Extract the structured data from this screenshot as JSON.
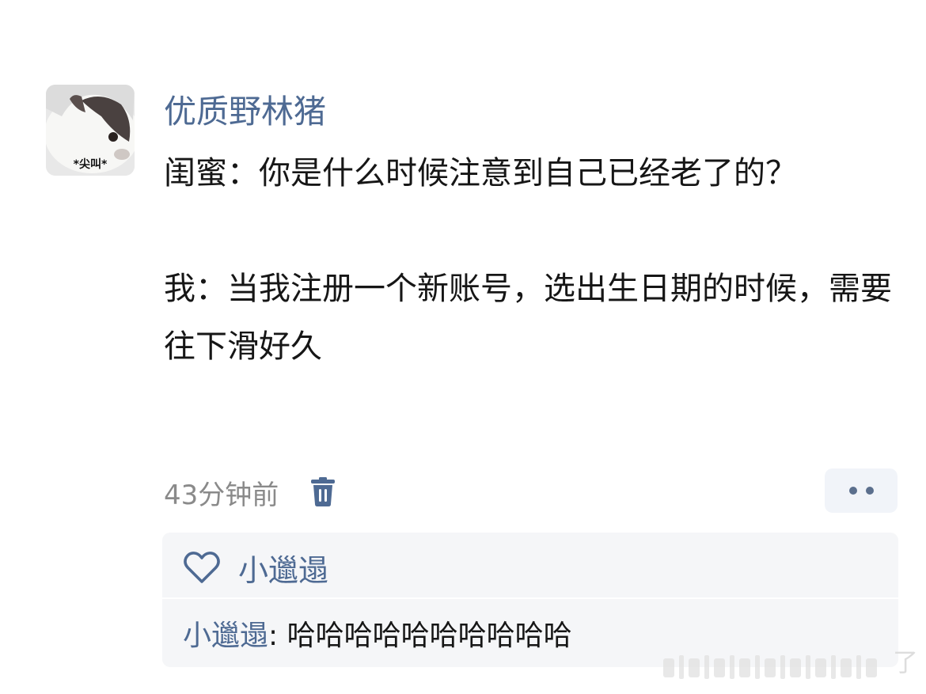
{
  "post": {
    "avatar_caption": "*尖叫*",
    "username": "优质野林猪",
    "paragraph1": "闺蜜：你是什么时候注意到自己已经老了的？",
    "paragraph2": "我：当我注册一个新账号，选出生日期的时候，需要往下滑好久",
    "timestamp": "43分钟前"
  },
  "actions": {
    "delete_icon": "trash-icon",
    "more_icon": "more-dots-icon"
  },
  "reply": {
    "like_icon": "heart-outline-icon",
    "liker": "小邋遢",
    "author": "小邋遢",
    "separator": ": ",
    "text": "哈哈哈哈哈哈哈哈哈哈"
  },
  "watermark": {
    "text": "了"
  },
  "colors": {
    "link": "#4e6a93",
    "text": "#161616",
    "muted": "#8a8a8a",
    "panel": "#f5f6f8"
  }
}
